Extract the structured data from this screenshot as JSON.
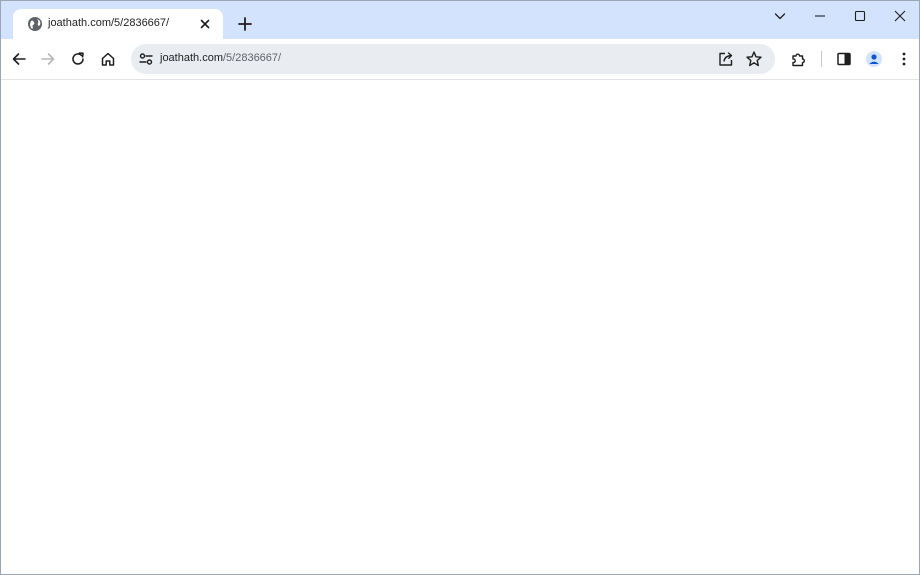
{
  "tab": {
    "title": "joathath.com/5/2836667/",
    "favicon": "globe-icon",
    "close_icon": "close-icon"
  },
  "window_controls": {
    "tab_search_icon": "chevron-down-icon",
    "minimize_icon": "minimize-icon",
    "maximize_icon": "maximize-icon",
    "close_icon": "close-icon"
  },
  "toolbar": {
    "back_icon": "arrow-left-icon",
    "forward_icon": "arrow-right-icon",
    "reload_icon": "reload-icon",
    "home_icon": "home-icon",
    "share_icon": "share-icon",
    "bookmark_icon": "star-icon",
    "extensions_icon": "puzzle-icon",
    "side_panel_icon": "side-panel-icon",
    "profile_icon": "profile-icon",
    "menu_icon": "kebab-menu-icon"
  },
  "omnibox": {
    "url_host": "joathath.com",
    "url_path": "/5/2836667/",
    "site_info_icon": "tune-icon"
  },
  "colors": {
    "tabstrip_bg": "#d3e3fd",
    "omnibox_bg": "#e9ecf1",
    "profile_accent": "#0b57d0",
    "forward_disabled": "#b8b8b8"
  }
}
